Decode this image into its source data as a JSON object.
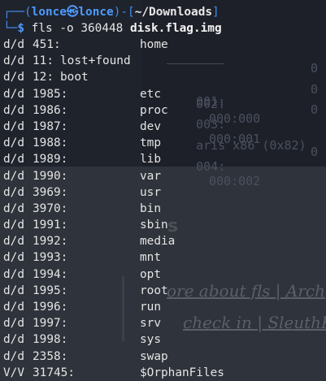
{
  "prompt": {
    "open": "┌──(",
    "user": "lonce",
    "at": "㉿",
    "host": "lonce",
    "close": ")-[",
    "path": "~/Downloads",
    "end": "]",
    "line2_prefix": "└─",
    "dollar": "$",
    "command": "fls",
    "args_plain": " -o 360448 ",
    "args_bold": "disk.flag.img"
  },
  "entries": [
    {
      "type": "d/d",
      "inode": "451:",
      "name": "home",
      "layout": "wide"
    },
    {
      "type": "d/d",
      "inode": "11:",
      "name": "lost+found",
      "layout": "short"
    },
    {
      "type": "d/d",
      "inode": "12:",
      "name": "boot",
      "layout": "short"
    },
    {
      "type": "d/d",
      "inode": "1985:",
      "name": "etc",
      "layout": "wide"
    },
    {
      "type": "d/d",
      "inode": "1986:",
      "name": "proc",
      "layout": "wide"
    },
    {
      "type": "d/d",
      "inode": "1987:",
      "name": "dev",
      "layout": "wide"
    },
    {
      "type": "d/d",
      "inode": "1988:",
      "name": "tmp",
      "layout": "wide"
    },
    {
      "type": "d/d",
      "inode": "1989:",
      "name": "lib",
      "layout": "wide"
    },
    {
      "type": "d/d",
      "inode": "1990:",
      "name": "var",
      "layout": "wide"
    },
    {
      "type": "d/d",
      "inode": "3969:",
      "name": "usr",
      "layout": "wide"
    },
    {
      "type": "d/d",
      "inode": "3970:",
      "name": "bin",
      "layout": "wide"
    },
    {
      "type": "d/d",
      "inode": "1991:",
      "name": "sbin",
      "layout": "wide"
    },
    {
      "type": "d/d",
      "inode": "1992:",
      "name": "media",
      "layout": "wide"
    },
    {
      "type": "d/d",
      "inode": "1993:",
      "name": "mnt",
      "layout": "wide"
    },
    {
      "type": "d/d",
      "inode": "1994:",
      "name": "opt",
      "layout": "wide"
    },
    {
      "type": "d/d",
      "inode": "1995:",
      "name": "root",
      "layout": "wide"
    },
    {
      "type": "d/d",
      "inode": "1996:",
      "name": "run",
      "layout": "wide"
    },
    {
      "type": "d/d",
      "inode": "1997:",
      "name": "srv",
      "layout": "wide"
    },
    {
      "type": "d/d",
      "inode": "1998:",
      "name": "sys",
      "layout": "wide"
    },
    {
      "type": "d/d",
      "inode": "2358:",
      "name": "swap",
      "layout": "wide"
    },
    {
      "type": "V/V",
      "inode": "31745:",
      "name": "$OrphanFiles",
      "layout": "wide"
    }
  ],
  "background": {
    "hex_rows": [
      {
        "a": "001:",
        "b": ""
      },
      {
        "a": "002:",
        "b": "000:000"
      },
      {
        "a": "003:",
        "b": "000:001"
      },
      {
        "a": "aris x86 (0x82)",
        "b": ""
      },
      {
        "a": "004:",
        "b": "000:002"
      }
    ],
    "right_digits": [
      "0",
      "0",
      "0",
      "0",
      "0",
      "0",
      "0"
    ],
    "heading_fragment": "s",
    "link1": "ore about fls | Arch",
    "link2": "check in | SleuthK"
  },
  "colors": {
    "prompt_blue": "#4d9bff",
    "text": "#e4e4e4",
    "background": "#1f232c"
  }
}
